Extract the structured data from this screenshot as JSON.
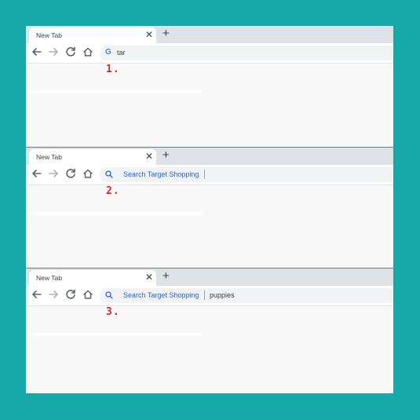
{
  "panels": [
    {
      "step": "1.",
      "tab_title": "New Tab",
      "tab_close": "✕",
      "new_tab": "+",
      "omnibox": {
        "icon": "google-g-icon",
        "icon_text": "G",
        "text": "tar"
      }
    },
    {
      "step": "2.",
      "tab_title": "New Tab",
      "tab_close": "✕",
      "new_tab": "+",
      "omnibox": {
        "icon": "search-icon",
        "keyword": "Search Target Shopping",
        "query": ""
      }
    },
    {
      "step": "3.",
      "tab_title": "New Tab",
      "tab_close": "✕",
      "new_tab": "+",
      "omnibox": {
        "icon": "search-icon",
        "keyword": "Search Target Shopping",
        "query": "puppies"
      }
    }
  ],
  "colors": {
    "background": "#15a8a6",
    "step_number": "#d42a2a",
    "keyword": "#2f63d6",
    "divider": "#e24b4b"
  }
}
